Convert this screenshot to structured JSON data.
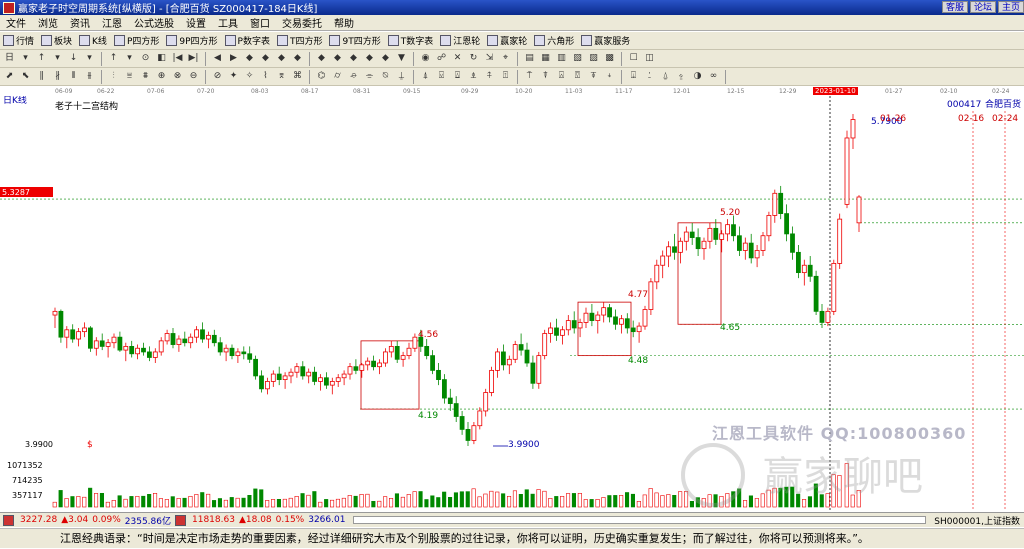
{
  "title": "赢家老子时空周期系统[纵横版] - [合肥百货   SZ000417-184日K线]",
  "title_buttons": [
    "客服",
    "论坛",
    "主页"
  ],
  "menu": [
    "文件",
    "浏览",
    "资讯",
    "江恩",
    "公式选股",
    "设置",
    "工具",
    "窗口",
    "交易委托",
    "帮助"
  ],
  "toolbar1": [
    "行情",
    "板块",
    "K线",
    "P四方形",
    "9P四方形",
    "P数字表",
    "T四方形",
    "9T四方形",
    "T数字表",
    "江恩轮",
    "赢家轮",
    "六角形",
    "赢家服务"
  ],
  "dates": [
    "06-09",
    "06-22",
    "07-06",
    "07-20",
    "08-03",
    "08-17",
    "08-31",
    "09-15",
    "09-29",
    "10-20",
    "11-03",
    "11-17",
    "12-01",
    "12-15",
    "12-29",
    "2023-01-10",
    "01-27",
    "02-10",
    "02-24"
  ],
  "chart_label": "日K线",
  "structure_label": "老子十二宫结构",
  "stock_code": "000417",
  "stock_name": "合肥百货",
  "price_marker": "5.3287",
  "low_label": "3.9900",
  "low_marker": "$",
  "axis_low": "3.9900",
  "vol_labels": [
    "1071352",
    "714235",
    "357117"
  ],
  "annotations": {
    "a456": "4.56",
    "a419": "4.19",
    "a477": "4.77",
    "a448": "4.48",
    "a520": "5.20",
    "a465": "4.65",
    "a5790": "5.7900",
    "d0126": "01-26",
    "d0216": "02-16",
    "d0224": "02-24"
  },
  "watermark1": "江恩工具软件  QQ:100800360",
  "watermark2": "赢家聊吧",
  "index1": {
    "value": "3227.28",
    "change": "▲3.04",
    "pct": "0.09%",
    "amount": "2355.86亿"
  },
  "index2": {
    "value": "11818.63",
    "change": "▲18.08",
    "pct": "0.15%",
    "amount": "3266.01"
  },
  "index_right": "SH000001,上证指数",
  "quote": "江恩经典语录：“时间是决定市场走势的重要因素，经过详细研究大市及个别股票的过往记录，你将可以证明，历史确实重复发生；而了解过往，你将可以预测将来。”。",
  "chart_data": {
    "type": "candlestick",
    "y_reference": {
      "price_marker": 5.3287,
      "low": 3.99,
      "high": 5.79
    },
    "boxes": [
      {
        "top": 4.56,
        "bottom": 4.19
      },
      {
        "top": 4.77,
        "bottom": 4.48
      },
      {
        "top": 5.2,
        "bottom": 4.65
      }
    ],
    "candles": [
      [
        4.7,
        4.74,
        4.63,
        4.72
      ],
      [
        4.72,
        4.73,
        4.55,
        4.58
      ],
      [
        4.58,
        4.64,
        4.52,
        4.62
      ],
      [
        4.62,
        4.65,
        4.55,
        4.57
      ],
      [
        4.57,
        4.63,
        4.53,
        4.61
      ],
      [
        4.61,
        4.66,
        4.58,
        4.63
      ],
      [
        4.63,
        4.64,
        4.5,
        4.52
      ],
      [
        4.52,
        4.58,
        4.48,
        4.56
      ],
      [
        4.56,
        4.6,
        4.51,
        4.53
      ],
      [
        4.53,
        4.57,
        4.47,
        4.55
      ],
      [
        4.55,
        4.6,
        4.52,
        4.58
      ],
      [
        4.58,
        4.61,
        4.5,
        4.51
      ],
      [
        4.51,
        4.55,
        4.45,
        4.53
      ],
      [
        4.53,
        4.56,
        4.47,
        4.49
      ],
      [
        4.49,
        4.54,
        4.46,
        4.52
      ],
      [
        4.52,
        4.55,
        4.48,
        4.5
      ],
      [
        4.5,
        4.53,
        4.45,
        4.47
      ],
      [
        4.47,
        4.52,
        4.44,
        4.5
      ],
      [
        4.5,
        4.58,
        4.48,
        4.56
      ],
      [
        4.56,
        4.62,
        4.54,
        4.6
      ],
      [
        4.6,
        4.63,
        4.52,
        4.54
      ],
      [
        4.54,
        4.59,
        4.5,
        4.57
      ],
      [
        4.57,
        4.61,
        4.53,
        4.55
      ],
      [
        4.55,
        4.6,
        4.52,
        4.58
      ],
      [
        4.58,
        4.64,
        4.55,
        4.62
      ],
      [
        4.62,
        4.66,
        4.55,
        4.57
      ],
      [
        4.57,
        4.61,
        4.52,
        4.59
      ],
      [
        4.59,
        4.62,
        4.53,
        4.55
      ],
      [
        4.55,
        4.58,
        4.48,
        4.5
      ],
      [
        4.5,
        4.54,
        4.45,
        4.52
      ],
      [
        4.52,
        4.54,
        4.46,
        4.48
      ],
      [
        4.48,
        4.52,
        4.44,
        4.5
      ],
      [
        4.5,
        4.53,
        4.46,
        4.49
      ],
      [
        4.49,
        4.53,
        4.44,
        4.46
      ],
      [
        4.46,
        4.48,
        4.35,
        4.37
      ],
      [
        4.37,
        4.4,
        4.28,
        4.3
      ],
      [
        4.3,
        4.36,
        4.27,
        4.34
      ],
      [
        4.34,
        4.4,
        4.31,
        4.38
      ],
      [
        4.38,
        4.42,
        4.32,
        4.35
      ],
      [
        4.35,
        4.39,
        4.3,
        4.37
      ],
      [
        4.37,
        4.41,
        4.33,
        4.39
      ],
      [
        4.39,
        4.44,
        4.36,
        4.42
      ],
      [
        4.42,
        4.45,
        4.35,
        4.37
      ],
      [
        4.37,
        4.41,
        4.33,
        4.39
      ],
      [
        4.39,
        4.42,
        4.32,
        4.34
      ],
      [
        4.34,
        4.38,
        4.29,
        4.36
      ],
      [
        4.36,
        4.39,
        4.3,
        4.32
      ],
      [
        4.32,
        4.36,
        4.27,
        4.34
      ],
      [
        4.34,
        4.38,
        4.31,
        4.36
      ],
      [
        4.36,
        4.4,
        4.32,
        4.38
      ],
      [
        4.38,
        4.44,
        4.35,
        4.42
      ],
      [
        4.42,
        4.46,
        4.38,
        4.4
      ],
      [
        4.4,
        4.44,
        4.36,
        4.43
      ],
      [
        4.43,
        4.47,
        4.4,
        4.45
      ],
      [
        4.45,
        4.48,
        4.4,
        4.42
      ],
      [
        4.42,
        4.46,
        4.38,
        4.44
      ],
      [
        4.44,
        4.52,
        4.42,
        4.5
      ],
      [
        4.5,
        4.56,
        4.47,
        4.53
      ],
      [
        4.53,
        4.56,
        4.44,
        4.46
      ],
      [
        4.46,
        4.5,
        4.42,
        4.48
      ],
      [
        4.48,
        4.55,
        4.46,
        4.52
      ],
      [
        4.52,
        4.6,
        4.5,
        4.58
      ],
      [
        4.58,
        4.62,
        4.5,
        4.53
      ],
      [
        4.53,
        4.57,
        4.46,
        4.48
      ],
      [
        4.48,
        4.51,
        4.38,
        4.4
      ],
      [
        4.4,
        4.44,
        4.32,
        4.35
      ],
      [
        4.35,
        4.38,
        4.22,
        4.25
      ],
      [
        4.25,
        4.3,
        4.18,
        4.22
      ],
      [
        4.22,
        4.26,
        4.12,
        4.15
      ],
      [
        4.15,
        4.18,
        4.05,
        4.08
      ],
      [
        4.08,
        4.12,
        3.99,
        4.02
      ],
      [
        4.02,
        4.12,
        4.0,
        4.1
      ],
      [
        4.1,
        4.2,
        4.08,
        4.18
      ],
      [
        4.18,
        4.3,
        4.15,
        4.28
      ],
      [
        4.28,
        4.42,
        4.26,
        4.4
      ],
      [
        4.4,
        4.52,
        4.36,
        4.5
      ],
      [
        4.5,
        4.54,
        4.4,
        4.43
      ],
      [
        4.43,
        4.48,
        4.38,
        4.46
      ],
      [
        4.46,
        4.56,
        4.44,
        4.54
      ],
      [
        4.54,
        4.6,
        4.48,
        4.51
      ],
      [
        4.51,
        4.55,
        4.42,
        4.44
      ],
      [
        4.44,
        4.48,
        4.3,
        4.33
      ],
      [
        4.33,
        4.5,
        4.3,
        4.48
      ],
      [
        4.48,
        4.62,
        4.46,
        4.6
      ],
      [
        4.6,
        4.66,
        4.55,
        4.63
      ],
      [
        4.63,
        4.68,
        4.56,
        4.59
      ],
      [
        4.59,
        4.64,
        4.54,
        4.62
      ],
      [
        4.62,
        4.7,
        4.59,
        4.67
      ],
      [
        4.67,
        4.72,
        4.6,
        4.63
      ],
      [
        4.63,
        4.68,
        4.58,
        4.66
      ],
      [
        4.66,
        4.74,
        4.63,
        4.71
      ],
      [
        4.71,
        4.76,
        4.64,
        4.67
      ],
      [
        4.67,
        4.72,
        4.6,
        4.7
      ],
      [
        4.7,
        4.77,
        4.66,
        4.74
      ],
      [
        4.74,
        4.76,
        4.66,
        4.69
      ],
      [
        4.69,
        4.73,
        4.62,
        4.65
      ],
      [
        4.65,
        4.7,
        4.6,
        4.68
      ],
      [
        4.68,
        4.71,
        4.6,
        4.63
      ],
      [
        4.63,
        4.67,
        4.58,
        4.61
      ],
      [
        4.61,
        4.66,
        4.55,
        4.64
      ],
      [
        4.64,
        4.75,
        4.62,
        4.73
      ],
      [
        4.73,
        4.9,
        4.7,
        4.88
      ],
      [
        4.88,
        5.0,
        4.84,
        4.97
      ],
      [
        4.97,
        5.05,
        4.9,
        5.02
      ],
      [
        5.02,
        5.1,
        4.96,
        5.07
      ],
      [
        5.07,
        5.14,
        5.0,
        5.04
      ],
      [
        5.04,
        5.12,
        4.98,
        5.1
      ],
      [
        5.1,
        5.18,
        5.05,
        5.15
      ],
      [
        5.15,
        5.2,
        5.08,
        5.12
      ],
      [
        5.12,
        5.17,
        5.02,
        5.06
      ],
      [
        5.06,
        5.12,
        5.0,
        5.1
      ],
      [
        5.1,
        5.2,
        5.06,
        5.17
      ],
      [
        5.17,
        5.22,
        5.08,
        5.11
      ],
      [
        5.11,
        5.16,
        5.04,
        5.14
      ],
      [
        5.14,
        5.22,
        5.1,
        5.19
      ],
      [
        5.19,
        5.24,
        5.1,
        5.13
      ],
      [
        5.13,
        5.18,
        5.02,
        5.05
      ],
      [
        5.05,
        5.12,
        5.0,
        5.09
      ],
      [
        5.09,
        5.14,
        4.98,
        5.01
      ],
      [
        5.01,
        5.08,
        4.96,
        5.05
      ],
      [
        5.05,
        5.15,
        5.02,
        5.13
      ],
      [
        5.13,
        5.26,
        5.1,
        5.24
      ],
      [
        5.24,
        5.38,
        5.2,
        5.36
      ],
      [
        5.36,
        5.4,
        5.22,
        5.25
      ],
      [
        5.25,
        5.3,
        5.1,
        5.14
      ],
      [
        5.14,
        5.18,
        5.0,
        5.04
      ],
      [
        5.04,
        5.08,
        4.9,
        4.93
      ],
      [
        4.93,
        5.0,
        4.86,
        4.97
      ],
      [
        4.97,
        5.02,
        4.88,
        4.91
      ],
      [
        4.91,
        4.94,
        4.7,
        4.72
      ],
      [
        4.72,
        4.76,
        4.63,
        4.66
      ],
      [
        4.66,
        4.74,
        4.64,
        4.72
      ],
      [
        4.72,
        5.0,
        4.7,
        4.98
      ],
      [
        4.98,
        5.25,
        4.95,
        5.22
      ],
      [
        5.3,
        5.7,
        5.28,
        5.66
      ],
      [
        5.66,
        5.79,
        5.6,
        5.76
      ],
      [
        5.2,
        5.35,
        5.15,
        5.34
      ]
    ],
    "volume_max": 1071352
  }
}
